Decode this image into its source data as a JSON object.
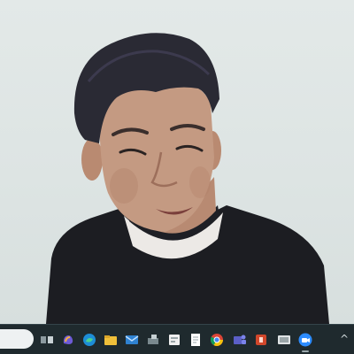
{
  "video_call": {
    "participant_video": "participant-video",
    "colors": {
      "background": "#dfe5e4",
      "shirt": "#1c1d22",
      "skin": "#c49a82",
      "hair": "#2a2a34"
    }
  },
  "taskbar": {
    "search_placeholder": "",
    "apps": [
      {
        "name": "task-view-icon",
        "color": "#5c6a70"
      },
      {
        "name": "copilot-icon",
        "color": "#7f67d8"
      },
      {
        "name": "edge-browser-icon",
        "color": "#1fa0b8"
      },
      {
        "name": "file-explorer-icon",
        "color": "#e9b631"
      },
      {
        "name": "mail-icon",
        "color": "#2f82d1"
      },
      {
        "name": "app-icon",
        "color": "#556468"
      },
      {
        "name": "calendar-icon",
        "color": "#e8e8e8"
      },
      {
        "name": "notepad-icon",
        "color": "#f2f2f2"
      },
      {
        "name": "chrome-icon",
        "color": "#e6b92f"
      },
      {
        "name": "teams-icon",
        "color": "#5b5fc7"
      },
      {
        "name": "powerpoint-icon",
        "color": "#d1472b"
      },
      {
        "name": "media-icon",
        "color": "#dfe3e5"
      },
      {
        "name": "zoom-icon",
        "color": "#2d8cff"
      }
    ],
    "tray_chevron": "^"
  }
}
